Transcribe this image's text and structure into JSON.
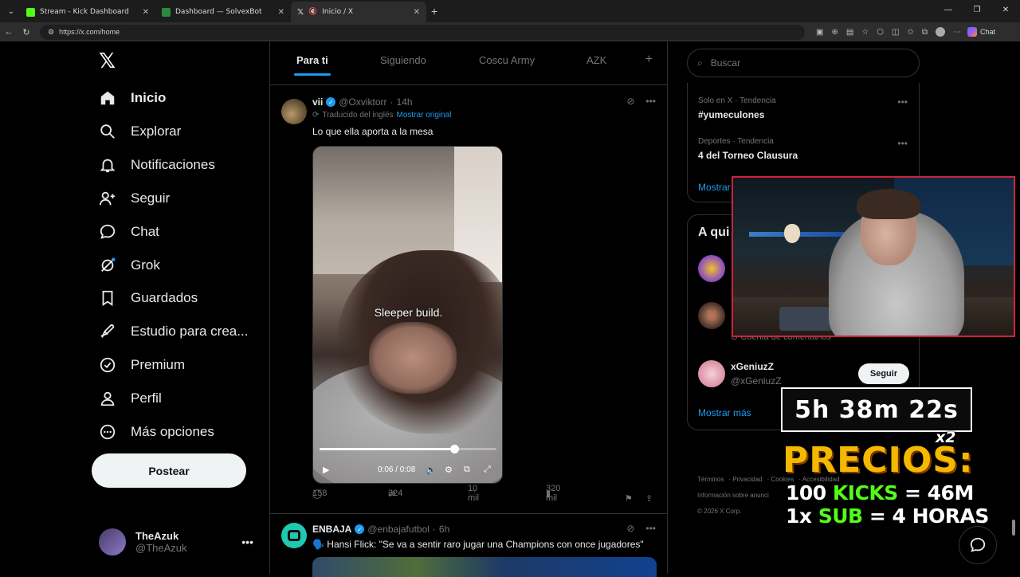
{
  "browser": {
    "tabs": [
      {
        "title": "Stream - Kick Dashboard",
        "favicon_color": "#53fc18",
        "active": false
      },
      {
        "title": "Dashboard — SolvexBot",
        "favicon_color": "#2b8a3e",
        "active": false
      },
      {
        "title": "Inicio / X",
        "favicon_color": "#ffffff",
        "active": true
      }
    ],
    "url": "https://x.com/home",
    "chat_label": "Chat"
  },
  "nav": {
    "items": [
      {
        "label": "Inicio",
        "icon": "home-icon"
      },
      {
        "label": "Explorar",
        "icon": "search-icon"
      },
      {
        "label": "Notificaciones",
        "icon": "bell-icon"
      },
      {
        "label": "Seguir",
        "icon": "follow-icon"
      },
      {
        "label": "Chat",
        "icon": "chat-icon"
      },
      {
        "label": "Grok",
        "icon": "grok-icon"
      },
      {
        "label": "Guardados",
        "icon": "bookmark-icon"
      },
      {
        "label": "Estudio para crea...",
        "icon": "rocket-icon"
      },
      {
        "label": "Premium",
        "icon": "premium-icon"
      },
      {
        "label": "Perfil",
        "icon": "profile-icon"
      },
      {
        "label": "Más opciones",
        "icon": "more-icon"
      }
    ],
    "post_label": "Postear",
    "me": {
      "name": "TheAzuk",
      "handle": "@TheAzuk"
    }
  },
  "feed": {
    "tabs": [
      "Para ti",
      "Siguiendo",
      "Coscu Army",
      "AZK"
    ],
    "post1": {
      "name": "vii",
      "handle": "@Oxviktorr",
      "time": "14h",
      "translated": "Traducido del inglés",
      "show_original": "Mostrar original",
      "text": "Lo que ella aporta a la mesa",
      "video_caption": "Sleeper build.",
      "video_time": "0:06 / 0:08",
      "video_progress": 0.76,
      "replies": "158",
      "reposts": "324",
      "likes": "10 mil",
      "views": "320 mil"
    },
    "post2": {
      "name": "ENBAJA",
      "handle": "@enbajafutbol",
      "time": "6h",
      "text": "🗣️ Hansi Flick: \"Se va a sentir raro jugar una Champions con once jugadores\""
    }
  },
  "sidebar": {
    "search_placeholder": "Buscar",
    "trends": [
      {
        "meta": "Solo en X · Tendencia",
        "title": "#yumeculones"
      },
      {
        "meta": "Deportes · Tendencia",
        "title": "4 del Torneo Clausura"
      }
    ],
    "show_more": "Mostrar más",
    "who_title": "A qui",
    "who_partial": "Cuenta de comentarios",
    "suggestion": {
      "name": "xGeniuzZ",
      "handle": "@xGeniuzZ",
      "follow_label": "Seguir"
    },
    "who_show_more": "Mostrar más",
    "footer": [
      "Términos",
      "Privacidad",
      "Cookies",
      "Accesibilidad",
      "Información sobre anunci",
      "© 2026 X Corp."
    ]
  },
  "overlay": {
    "timer": "5h 38m 22s",
    "multiplier": "x2",
    "precios": "PRECIOS:",
    "line1_a": "100 ",
    "line1_b": "KICKS",
    "line1_c": " = 46M",
    "line2_a": "1x ",
    "line2_b": "SUB",
    "line2_c": " = 4 HORAS"
  },
  "colors": {
    "accent": "#1d9bf0",
    "kick_green": "#53fc18",
    "webcam_border": "#d0223b",
    "precios": "#f5b800"
  }
}
